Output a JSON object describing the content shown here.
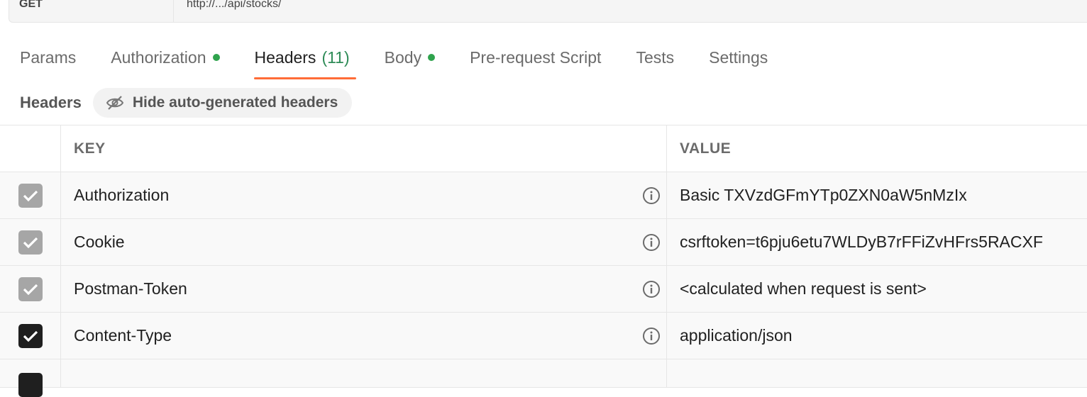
{
  "request": {
    "method": "GET",
    "url": "http://.../api/stocks/"
  },
  "tabs": [
    {
      "label": "Params",
      "dot": false
    },
    {
      "label": "Authorization",
      "dot": true
    },
    {
      "label": "Headers",
      "count": "(11)",
      "active": true
    },
    {
      "label": "Body",
      "dot": true
    },
    {
      "label": "Pre-request Script"
    },
    {
      "label": "Tests"
    },
    {
      "label": "Settings"
    }
  ],
  "headers_section": {
    "title": "Headers",
    "hide_button": "Hide auto-generated headers"
  },
  "table": {
    "columns": {
      "key": "KEY",
      "value": "VALUE"
    },
    "rows": [
      {
        "key": "Authorization",
        "value": "Basic TXVzdGFmYTp0ZXN0aW5nMzIx",
        "checked": true,
        "auto": true
      },
      {
        "key": "Cookie",
        "value": "csrftoken=t6pju6etu7WLDyB7rFFiZvHFrs5RACXF",
        "checked": true,
        "auto": true
      },
      {
        "key": "Postman-Token",
        "value": "<calculated when request is sent>",
        "checked": true,
        "auto": true
      },
      {
        "key": "Content-Type",
        "value": "application/json",
        "checked": true,
        "auto": false
      }
    ]
  },
  "colors": {
    "accent": "#ff6c37",
    "status_dot": "#2fa34d",
    "count": "#2e8b57"
  }
}
